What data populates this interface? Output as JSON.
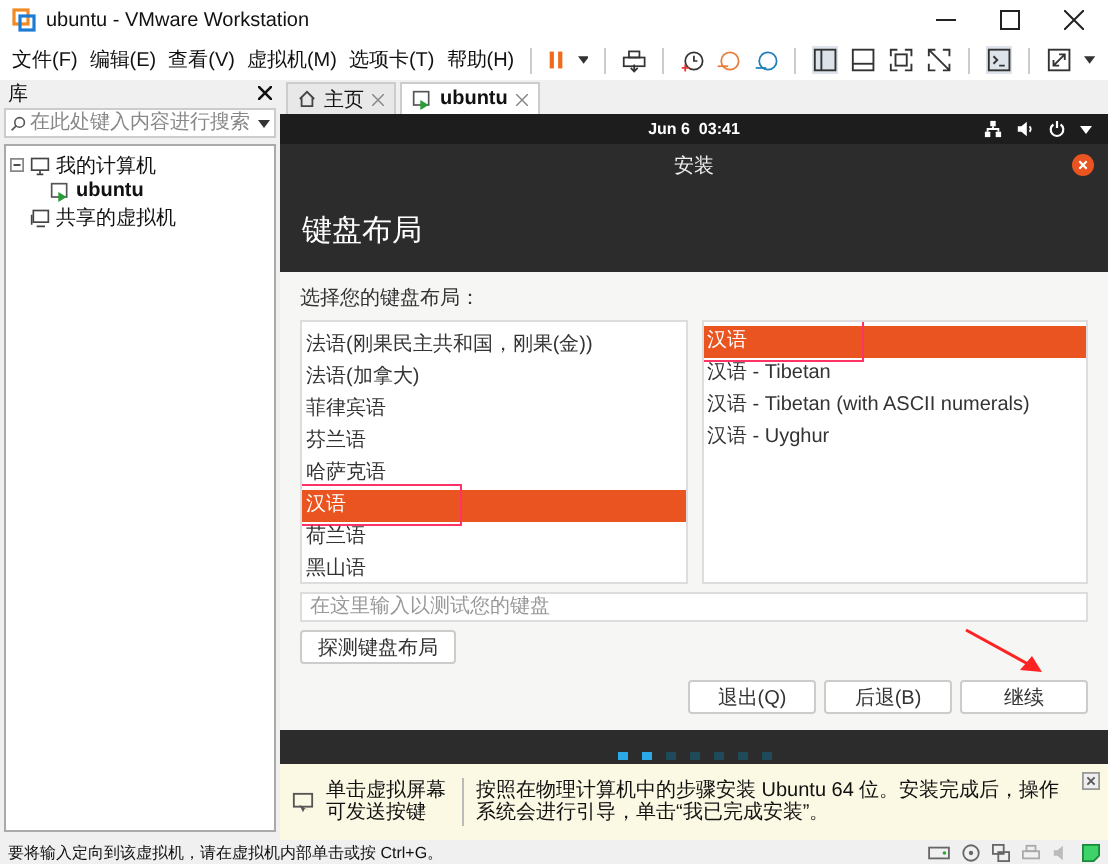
{
  "window": {
    "title": "ubuntu - VMware Workstation"
  },
  "menu": [
    "文件(F)",
    "编辑(E)",
    "查看(V)",
    "虚拟机(M)",
    "选项卡(T)",
    "帮助(H)"
  ],
  "library": {
    "title": "库",
    "search": {
      "placeholder": "在此处键入内容进行搜索"
    },
    "tree": [
      {
        "label": "我的计算机",
        "kind": "computer",
        "expanded": true,
        "children": [
          {
            "label": "ubuntu",
            "kind": "vm"
          }
        ]
      },
      {
        "label": "共享的虚拟机",
        "kind": "shared"
      }
    ]
  },
  "tabs": [
    {
      "label": "主页",
      "kind": "home",
      "selected": false
    },
    {
      "label": "ubuntu",
      "kind": "vm",
      "selected": true
    }
  ],
  "guest": {
    "clock": "Jun 6  03:41",
    "dialog_title": "安装",
    "heading": "键盘布局",
    "prompt": "选择您的键盘布局：",
    "layouts": [
      {
        "label": "法语(刚果民主共和国，刚果(金))",
        "selected": false
      },
      {
        "label": "法语(加拿大)",
        "selected": false
      },
      {
        "label": "菲律宾语",
        "selected": false
      },
      {
        "label": "芬兰语",
        "selected": false
      },
      {
        "label": "哈萨克语",
        "selected": false
      },
      {
        "label": "汉语",
        "selected": true
      },
      {
        "label": "荷兰语",
        "selected": false
      },
      {
        "label": "黑山语",
        "selected": false
      }
    ],
    "variants": [
      {
        "label": "汉语",
        "selected": true
      },
      {
        "label": "汉语 - Tibetan",
        "selected": false
      },
      {
        "label": "汉语 - Tibetan (with ASCII numerals)",
        "selected": false
      },
      {
        "label": "汉语 - Uyghur",
        "selected": false
      }
    ],
    "test_field": {
      "placeholder": "在这里输入以测试您的键盘"
    },
    "detect_button": "探测键盘布局",
    "buttons": [
      "退出(Q)",
      "后退(B)",
      "继续"
    ],
    "progress_dots": [
      {
        "done": true
      },
      {
        "done": true
      },
      {
        "done": false
      },
      {
        "done": false
      },
      {
        "done": false
      },
      {
        "done": false
      },
      {
        "done": false
      }
    ]
  },
  "info_bar": {
    "hint": "单击虚拟屏幕可发送按键",
    "message": "按照在物理计算机中的步骤安装 Ubuntu 64 位。安装完成后，操作系统会进行引导，单击“我已完成安装”。"
  },
  "status_bar": {
    "text": "要将输入定向到该虚拟机，请在虚拟机内部单击或按 Ctrl+G。"
  }
}
